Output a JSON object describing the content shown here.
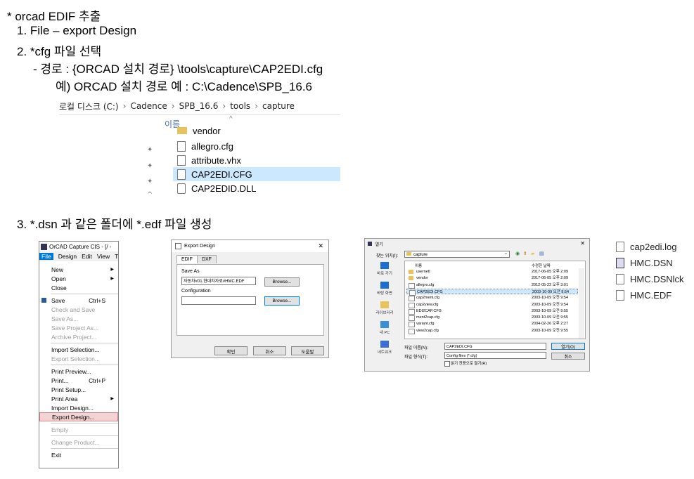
{
  "heading": "* orcad EDIF 추출",
  "step1": "1. File – export Design",
  "step2": "2. *cfg 파일 선택",
  "path_line": "- 경로 : {ORCAD 설치 경로} \\tools\\capture\\CAP2EDI.cfg",
  "example_line": "예) ORCAD 설치 경로 예 : C:\\Cadence\\SPB_16.6",
  "step3": "3. *.dsn 과 같은 폴더에 *.edf 파일 생성",
  "explorer": {
    "breadcrumb": [
      "로컬 디스크 (C:)",
      "Cadence",
      "SPB_16.6",
      "tools",
      "capture"
    ],
    "separator": "›",
    "column_header": "이름",
    "sort_glyph": "^",
    "files": [
      "vendor",
      "allegro.cfg",
      "attribute.vhx",
      "CAP2EDI.CFG",
      "CAP2EDID.DLL"
    ]
  },
  "orcad": {
    "title": "OrCAD Capture CIS - [/ -",
    "menubar": [
      "File",
      "Design",
      "Edit",
      "View",
      "T"
    ],
    "items": [
      {
        "label": "New",
        "arrow": true
      },
      {
        "label": "Open",
        "arrow": true
      },
      {
        "label": "Close"
      },
      {
        "sep": true
      },
      {
        "label": "Save",
        "shortcut": "Ctrl+S"
      },
      {
        "label": "Check and Save",
        "disabled": true
      },
      {
        "label": "Save As...",
        "disabled": true
      },
      {
        "label": "Save Project As...",
        "disabled": true
      },
      {
        "label": "Archive Project...",
        "disabled": true
      },
      {
        "sep": true
      },
      {
        "label": "Import Selection..."
      },
      {
        "label": "Export Selection...",
        "disabled": true
      },
      {
        "sep": true
      },
      {
        "label": "Print Preview..."
      },
      {
        "label": "Print...",
        "shortcut": "Ctrl+P"
      },
      {
        "label": "Print Setup..."
      },
      {
        "label": "Print Area",
        "arrow": true
      },
      {
        "label": "Import Design..."
      },
      {
        "label": "Export Design...",
        "highlight": true
      },
      {
        "sep": true
      },
      {
        "label": "Empty",
        "disabled": true
      },
      {
        "sep": true
      },
      {
        "label": "Change Product...",
        "disabled": true
      },
      {
        "sep": true
      },
      {
        "label": "Exit"
      }
    ]
  },
  "export_dialog": {
    "title": "Export Design",
    "close": "✕",
    "tabs": [
      "EDIF",
      "DXF"
    ],
    "save_as_label": "Save As",
    "save_as_value": "자동차#01.현대차자료#HMC.EDF",
    "browse": "Browse...",
    "configuration_label": "Configuration",
    "ok": "확인",
    "cancel": "취소",
    "help": "도움말"
  },
  "open_dialog": {
    "title": "열기",
    "close": "✕",
    "look_in_label": "찾는 위치(I):",
    "look_in_value": "capture",
    "col_name": "이름",
    "col_date": "수정한 날짜",
    "places": [
      "바로 가기",
      "바탕 화면",
      "라이브러리",
      "내 PC",
      "네트워크"
    ],
    "rows": [
      {
        "name": "usernetl",
        "date": "2017-06-05 오후 2:09",
        "folder": true
      },
      {
        "name": "vendor",
        "date": "2017-06-05 오후 2:09",
        "folder": true
      },
      {
        "name": "allegro.cfg",
        "date": "2012-05-22 오후 3:01"
      },
      {
        "name": "CAP2EDI.CFG",
        "date": "2003-10-09 오전 9:54",
        "selected": true
      },
      {
        "name": "cap2ment.cfg",
        "date": "2003-10-09 오전 9:54"
      },
      {
        "name": "cap2view.cfg",
        "date": "2003-10-09 오전 9:54"
      },
      {
        "name": "EDI2CAP.CFG",
        "date": "2003-10-09 오전 9:55"
      },
      {
        "name": "ment2cap.cfg",
        "date": "2003-10-09 오전 9:55"
      },
      {
        "name": "variant.cfg",
        "date": "2004-02-26 오후 2:27"
      },
      {
        "name": "view2cap.cfg",
        "date": "2003-10-09 오전 9:55"
      }
    ],
    "filename_label": "파일 이름(N):",
    "filename_value": "CAP2EDI.CFG",
    "filetype_label": "파일 형식(T):",
    "filetype_value": "Config files (*.cfg)",
    "readonly_label": "읽기 전용으로 열기(R)",
    "open_btn": "열기(O)",
    "cancel_btn": "취소"
  },
  "right_files": [
    "cap2edi.log",
    "HMC.DSN",
    "HMC.DSNlck",
    "HMC.EDF"
  ]
}
